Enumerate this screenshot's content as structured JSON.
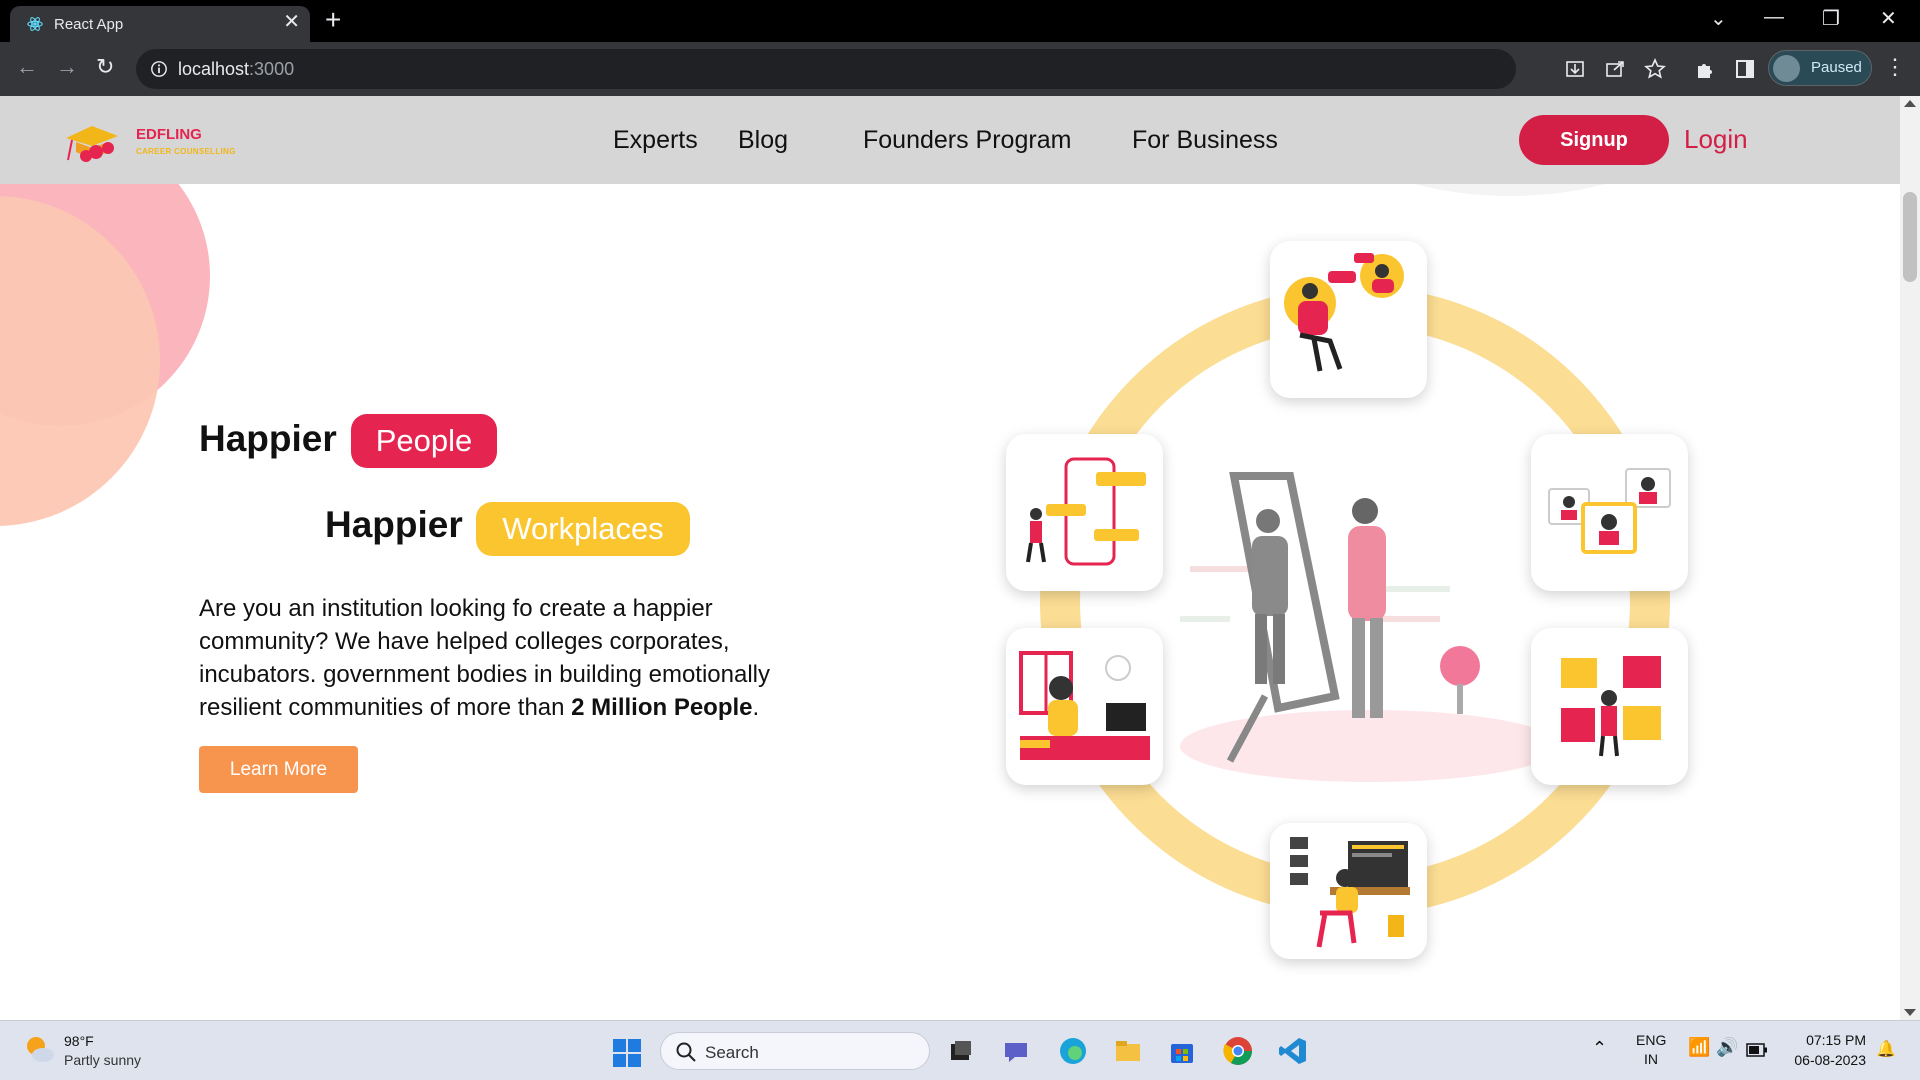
{
  "browser": {
    "tab_title": "React App",
    "url_host": "localhost",
    "url_port": ":3000",
    "profile_status": "Paused"
  },
  "nav": {
    "brand": "EDFLING",
    "brand_sub": "CAREER COUNSELLING",
    "links": [
      "Experts",
      "Blog",
      "Founders Program",
      "For Business"
    ],
    "signup": "Signup",
    "login": "Login"
  },
  "hero": {
    "line1_word": "Happier",
    "line1_pill": "People",
    "line2_word": "Happier",
    "line2_pill": "Workplaces",
    "desc_text": "Are you an institution looking fo create a happier community? We have helped colleges corporates, incubators. government bodies in building emotionally resilient communities of more than ",
    "desc_bold": "2 Million People",
    "desc_end": ".",
    "cta": "Learn More"
  },
  "colors": {
    "primary": "#d31f46",
    "accent_yellow": "#fbc530",
    "cta_orange": "#f7954f",
    "ring": "#fbdd93"
  },
  "taskbar": {
    "weather_temp": "98°F",
    "weather_desc": "Partly sunny",
    "search": "Search",
    "lang1": "ENG",
    "lang2": "IN",
    "time": "07:15 PM",
    "date": "06-08-2023"
  }
}
